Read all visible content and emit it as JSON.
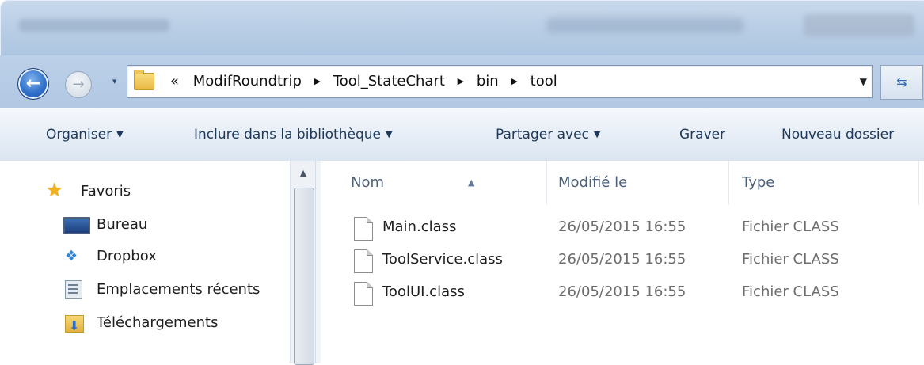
{
  "navigation": {
    "back_icon": "arrow-left-icon",
    "forward_icon": "arrow-right-icon",
    "recent_pages_caret": "▾",
    "breadcrumb_prefix": "«",
    "breadcrumb": [
      "ModifRoundtrip",
      "Tool_StateChart",
      "bin",
      "tool"
    ],
    "separator": "▶",
    "address_dropdown": "▼",
    "refresh_icon": "refresh-icon"
  },
  "toolbar": {
    "organize": "Organiser",
    "include_library": "Inclure dans la bibliothèque",
    "share_with": "Partager avec",
    "burn": "Graver",
    "new_folder": "Nouveau dossier",
    "caret": "▼"
  },
  "sidebar": {
    "favorites_label": "Favoris",
    "items": [
      {
        "label": "Bureau",
        "icon": "desktop-icon"
      },
      {
        "label": "Dropbox",
        "icon": "dropbox-icon"
      },
      {
        "label": "Emplacements récents",
        "icon": "recent-places-icon"
      },
      {
        "label": "Téléchargements",
        "icon": "downloads-folder-icon"
      }
    ]
  },
  "file_list": {
    "columns": {
      "name": "Nom",
      "modified": "Modifié le",
      "type": "Type"
    },
    "sort_indicator": "▲",
    "rows": [
      {
        "name": "Main.class",
        "modified": "26/05/2015 16:55",
        "type": "Fichier CLASS"
      },
      {
        "name": "ToolService.class",
        "modified": "26/05/2015 16:55",
        "type": "Fichier CLASS"
      },
      {
        "name": "ToolUI.class",
        "modified": "26/05/2015 16:55",
        "type": "Fichier CLASS"
      }
    ]
  },
  "colors": {
    "chrome_blue": "#b8cde5",
    "command_text": "#1e395b",
    "folder_yellow": "#e9b844",
    "star_gold": "#f2b21c"
  }
}
